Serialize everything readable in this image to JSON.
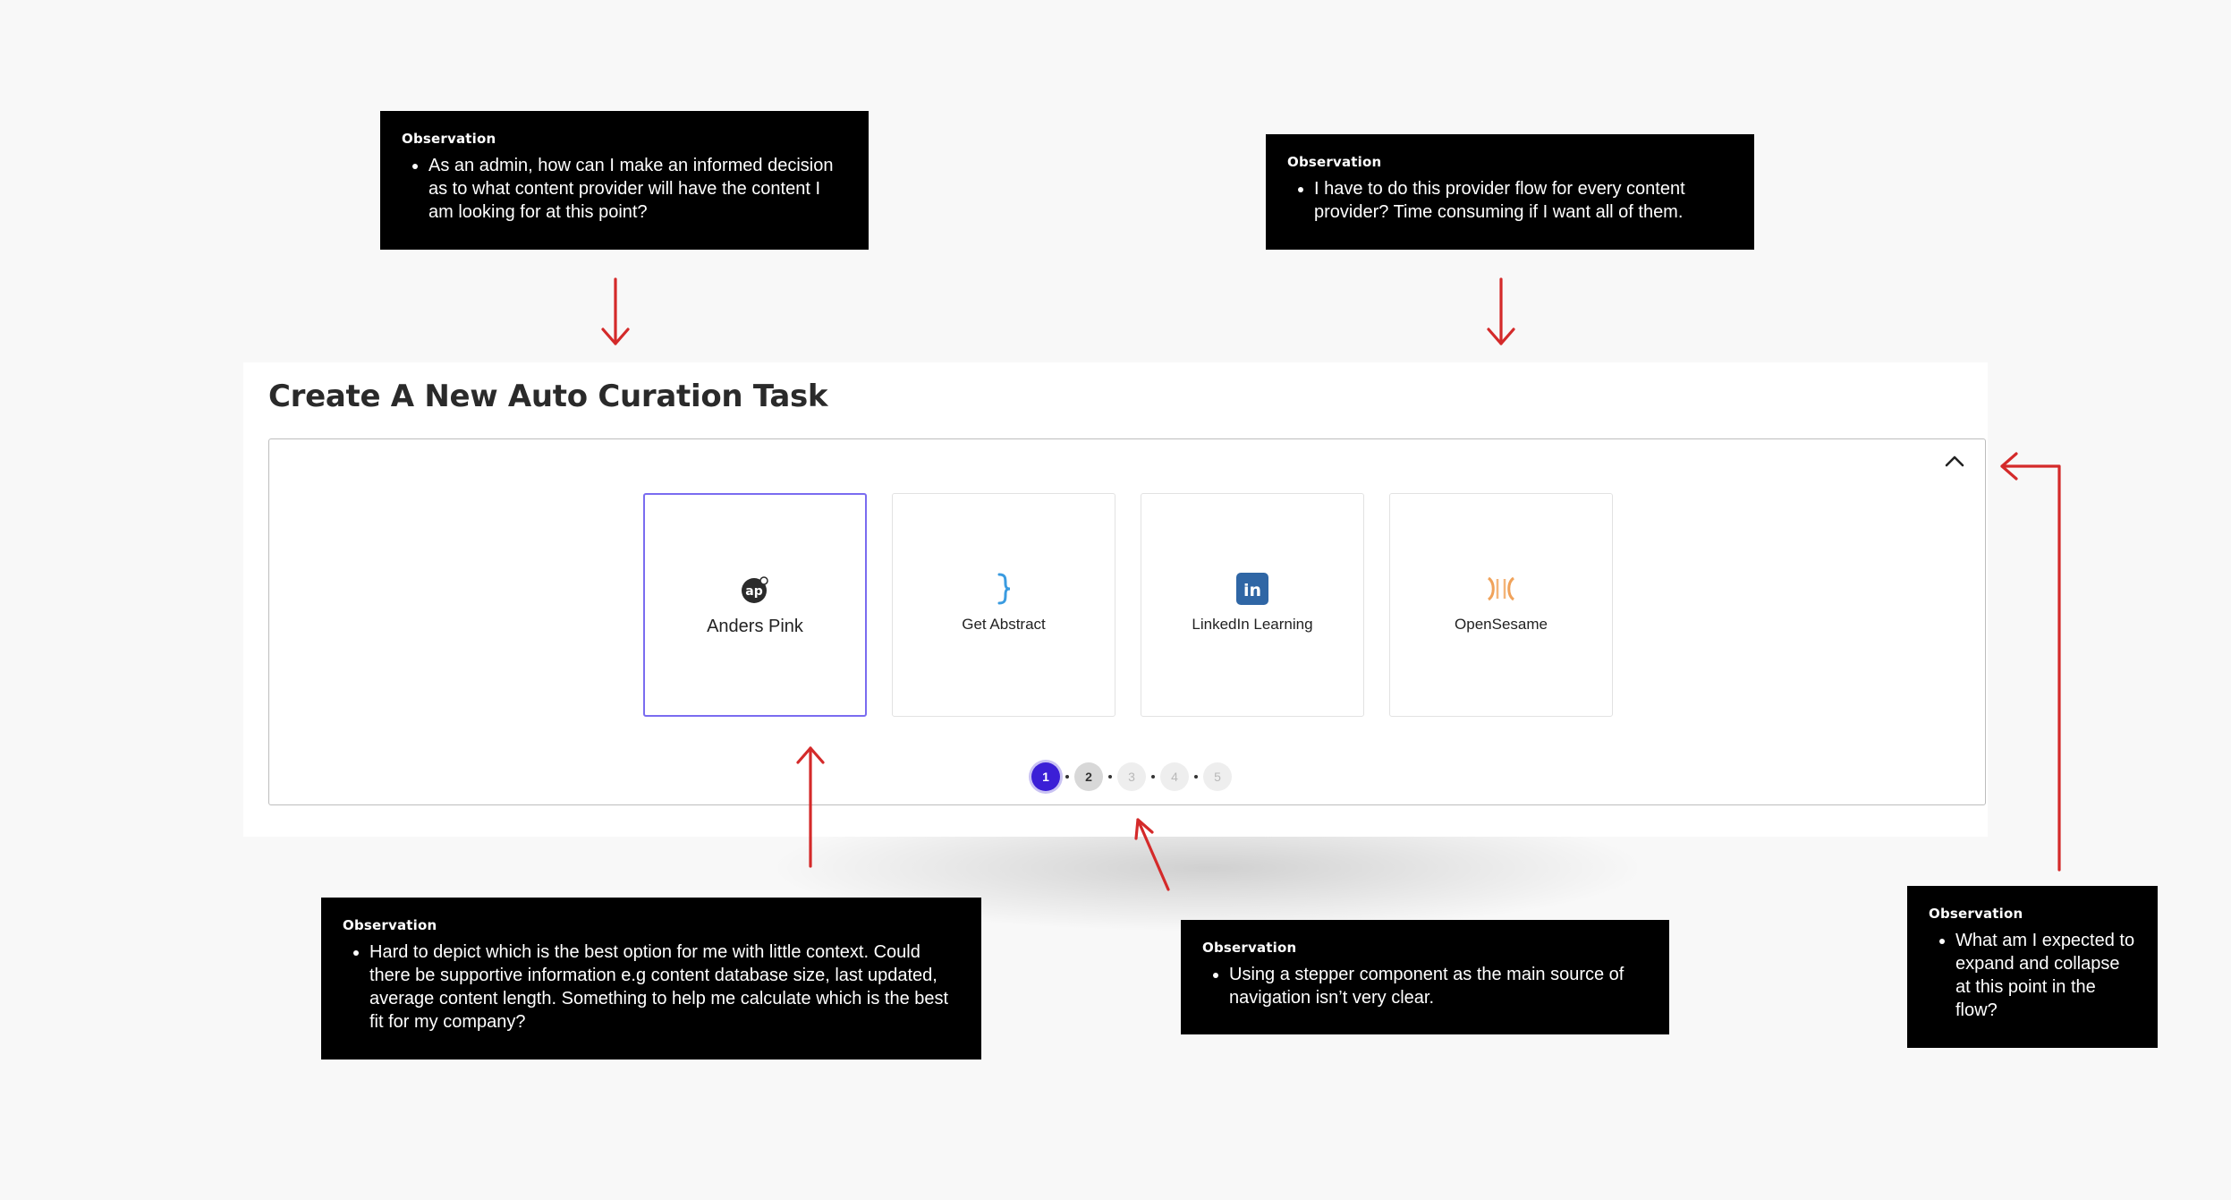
{
  "page": {
    "title": "Create A New Auto Curation Task"
  },
  "providers": [
    {
      "name": "Anders Pink",
      "icon": "anders-pink-logo-icon",
      "selected": true
    },
    {
      "name": "Get Abstract",
      "icon": "get-abstract-logo-icon",
      "selected": false
    },
    {
      "name": "LinkedIn Learning",
      "icon": "linkedin-logo-icon",
      "selected": false
    },
    {
      "name": "OpenSesame",
      "icon": "opensesame-logo-icon",
      "selected": false
    }
  ],
  "stepper": {
    "steps": [
      "1",
      "2",
      "3",
      "4",
      "5"
    ],
    "current": 1
  },
  "logos": {
    "anders_pink": "ap",
    "linkedin": "in"
  },
  "observations": [
    {
      "title": "Observation",
      "text": "As an admin, how can I make an informed decision as to what content provider will have the content I am looking for at this point?"
    },
    {
      "title": "Observation",
      "text": "I have to do this provider flow for every content provider? Time consuming if I want all of them."
    },
    {
      "title": "Observation",
      "text": "Hard to depict which is the best option for me with little context. Could there be supportive information e.g content database size, last updated, average content length. Something to help me calculate which is the best fit for my company?"
    },
    {
      "title": "Observation",
      "text": "Using a stepper component as the main source of navigation isn’t very clear."
    },
    {
      "title": "Observation",
      "text": "What am I expected to expand and collapse at this point in the flow?"
    }
  ],
  "colors": {
    "accent": "#3b1fd6",
    "selected_border": "#7a6cf0",
    "annotation_arrow": "#d42a2a",
    "linkedin_blue": "#2f66a5",
    "get_abstract_blue": "#3a9be0",
    "opensesame_orange": "#f0a25a"
  }
}
